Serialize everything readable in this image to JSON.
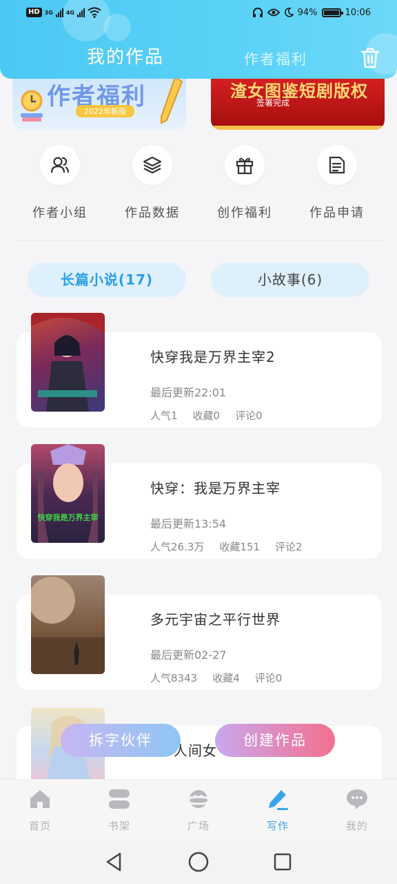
{
  "status_bar": {
    "hd_label": "HD",
    "network_left": "3G",
    "network_right": "4G",
    "battery": "94%",
    "time": "10:06"
  },
  "header": {
    "tab_active": "我的作品",
    "tab_inactive": "作者福利",
    "delete_icon": "trash-icon"
  },
  "banners": [
    {
      "title": "作者福利",
      "subtitle": "2022年新版"
    },
    {
      "title": "渣女图鉴短剧版权",
      "subtitle": "签署完成"
    }
  ],
  "quick_actions": [
    {
      "label": "作者小组",
      "icon": "group-icon"
    },
    {
      "label": "作品数据",
      "icon": "layers-icon"
    },
    {
      "label": "创作福利",
      "icon": "gift-icon"
    },
    {
      "label": "作品申请",
      "icon": "document-icon"
    }
  ],
  "categories": [
    {
      "label": "长篇小说(17)"
    },
    {
      "label": "小故事(6)"
    }
  ],
  "works": [
    {
      "title": "快穿我是万界主宰2",
      "updated": "最后更新22:01",
      "popularity": "人气1",
      "favorites": "收藏0",
      "comments": "评论0"
    },
    {
      "title": "快穿：我是万界主宰",
      "updated": "最后更新13:54",
      "popularity": "人气26.3万",
      "favorites": "收藏151",
      "comments": "评论2",
      "cover_text": "快穿我是万界主宰"
    },
    {
      "title": "多元宇宙之平行世界",
      "updated": "最后更新02-27",
      "popularity": "人气8343",
      "favorites": "收藏4",
      "comments": "评论0"
    },
    {
      "title": "人间女",
      "updated": "",
      "popularity": "",
      "favorites": "",
      "comments": ""
    }
  ],
  "fab": {
    "partner": "拆字伙伴",
    "create": "创建作品"
  },
  "bottom_nav": [
    {
      "label": "首页",
      "icon": "home-icon"
    },
    {
      "label": "书架",
      "icon": "bookshelf-icon"
    },
    {
      "label": "广场",
      "icon": "planet-icon"
    },
    {
      "label": "写作",
      "icon": "pen-icon",
      "active": true
    },
    {
      "label": "我的",
      "icon": "chat-icon"
    }
  ],
  "colors": {
    "header": "#4cc8f4",
    "accent": "#3aa4ea",
    "create_gradient_end": "#f3708c"
  }
}
